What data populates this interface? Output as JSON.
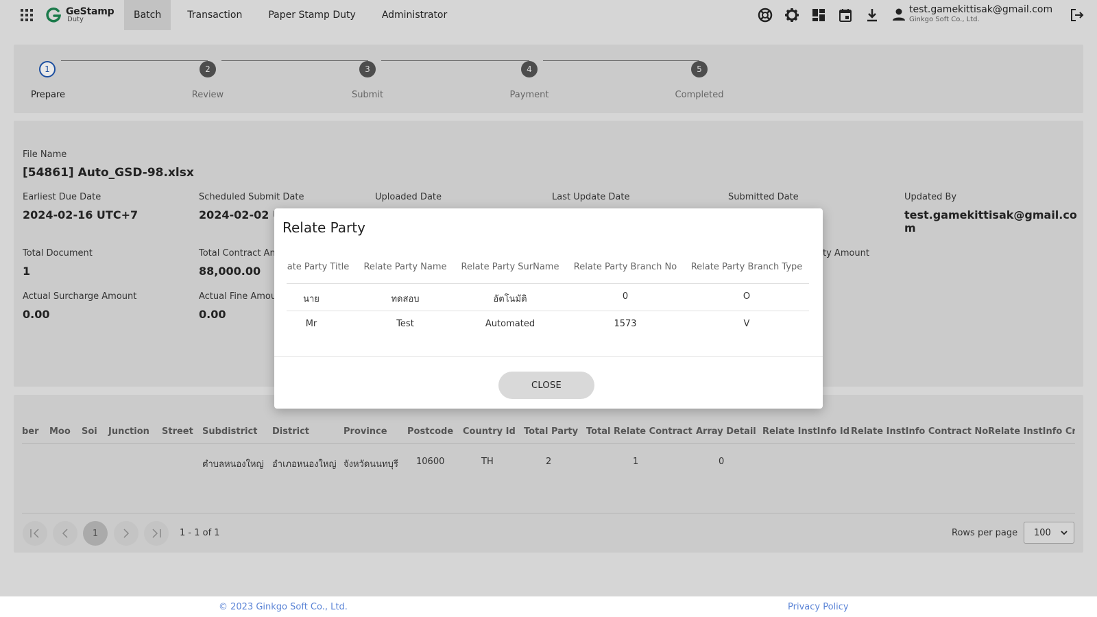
{
  "app": {
    "logo_main": "GeStamp",
    "logo_sub": "Duty",
    "nav": [
      "Batch",
      "Transaction",
      "Paper Stamp Duty",
      "Administrator"
    ],
    "active_nav": "Batch",
    "top_icons": [
      "support-icon",
      "gear-icon",
      "dashboard-icon",
      "calendar-icon",
      "download-icon"
    ],
    "user_email": "test.gamekittisak@gmail.com",
    "user_company": "Ginkgo Soft Co., Ltd."
  },
  "stepper": {
    "steps": [
      {
        "number": "1",
        "label": "Prepare"
      },
      {
        "number": "2",
        "label": "Review"
      },
      {
        "number": "3",
        "label": "Submit"
      },
      {
        "number": "4",
        "label": "Payment"
      },
      {
        "number": "5",
        "label": "Completed"
      }
    ],
    "current_step": 1
  },
  "info": {
    "file_name_label": "File Name",
    "file_name": "[54861] Auto_GSD-98.xlsx",
    "earliest_due_date_label": "Earliest Due Date",
    "earliest_due_date": "2024-02-16 UTC+7",
    "scheduled_submit_date_label": "Scheduled Submit Date",
    "scheduled_submit_date": "2024-02-02 U",
    "uploaded_date_label": "Uploaded Date",
    "last_update_date_label": "Last Update Date",
    "submitted_date_label": "Submitted Date",
    "updated_by_label": "Updated By",
    "updated_by_line1": "test.gamekittisak@gmail.co",
    "updated_by_line2": "m",
    "total_document_label": "Total Document",
    "total_document": "1",
    "total_contract_label": "Total Contract An",
    "total_contract": "88,000.00",
    "duty_amount_label": "ty Amount",
    "actual_surcharge_label": "Actual Surcharge Amount",
    "actual_surcharge": "0.00",
    "actual_fine_label": "Actual Fine Amou",
    "actual_fine": "0.00"
  },
  "table": {
    "headers": [
      "ber",
      "Moo",
      "Soi",
      "Junction",
      "Street",
      "Subdistrict",
      "District",
      "Province",
      "Postcode",
      "Country Id",
      "Total Party",
      "Total Relate Contract",
      "Array Detail",
      "Relate InstInfo Id",
      "Relate InstInfo Contract No.",
      "Relate InstInfo Cred"
    ],
    "row": {
      "subdistrict": "ตำบลหนองใหญ่",
      "district": "อำเภอหนองใหญ่",
      "province": "จังหวัดนนทบุรี",
      "postcode": "10600",
      "country_id": "TH",
      "total_party": "2",
      "total_relate_contract": "1",
      "array_detail": "0"
    },
    "pager": {
      "current_page": "1",
      "range": "1 - 1 of 1",
      "rows_per_page_label": "Rows per page",
      "rows_per_page": "100"
    }
  },
  "footer": {
    "copyright": "© 2023 Ginkgo Soft Co., Ltd.",
    "privacy": "Privacy Policy"
  },
  "modal": {
    "title": "Relate Party",
    "headers": [
      "ate Party Title",
      "Relate Party Name",
      "Relate Party SurName",
      "Relate Party Branch No",
      "Relate Party Branch Type"
    ],
    "rows": [
      [
        "นาย",
        "ทดสอบ",
        "อัตโนมัติ",
        "0",
        "O"
      ],
      [
        "Mr",
        "Test",
        "Automated",
        "1573",
        "V"
      ]
    ],
    "close_label": "CLOSE"
  },
  "colors": {
    "page_bg": "#d6d6d6",
    "panel_bg": "#cbcbcb",
    "step_active": "#1d4fa0",
    "link": "#5b84d6"
  }
}
